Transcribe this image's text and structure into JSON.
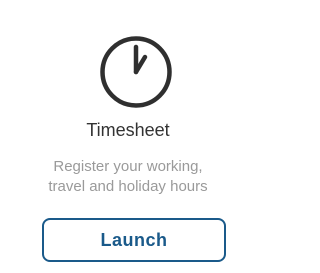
{
  "card": {
    "icon": "clock-icon",
    "title": "Timesheet",
    "description_lines": [
      "Register your working,",
      "travel and holiday hours"
    ],
    "button_label": "Launch"
  },
  "colors": {
    "icon": "#2f2f2f",
    "title": "#333333",
    "description": "#9a9a9a",
    "accent": "#1a5a8a",
    "background": "#ffffff"
  }
}
